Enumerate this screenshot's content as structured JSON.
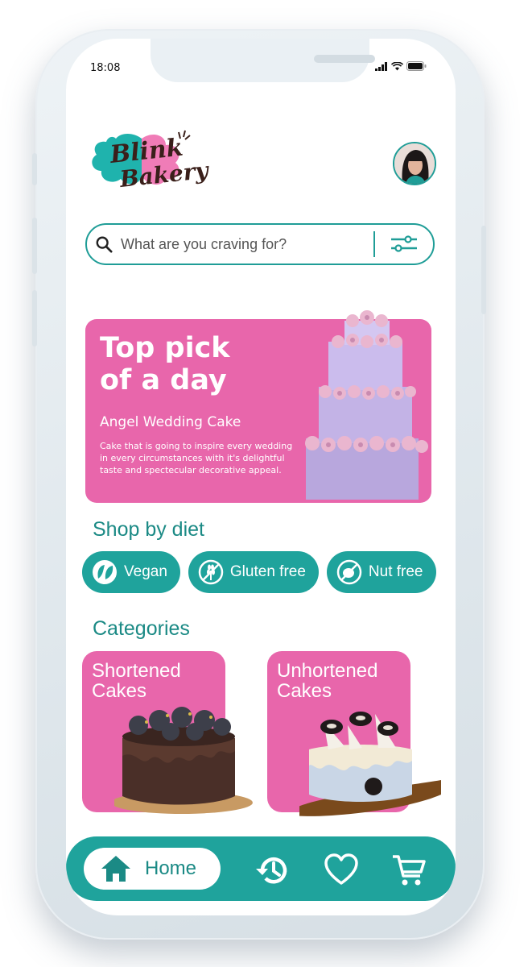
{
  "status_bar": {
    "time": "18:08"
  },
  "brand": {
    "line1": "Blink",
    "line2": "Bakery"
  },
  "search": {
    "placeholder": "What are you craving for?"
  },
  "banner": {
    "title_line1": "Top pick",
    "title_line2": "of a day",
    "product": "Angel Wedding Cake",
    "description": "Cake that is going to inspire every wedding in every circumstances with it's delightful taste and spectecular decorative appeal."
  },
  "diet": {
    "heading": "Shop by diet",
    "items": [
      {
        "label": "Vegan",
        "icon": "leaf-icon"
      },
      {
        "label": "Gluten free",
        "icon": "wheat-icon"
      },
      {
        "label": "Nut free",
        "icon": "nut-icon"
      }
    ]
  },
  "categories": {
    "heading": "Categories",
    "items": [
      {
        "label": "Shortened Cakes"
      },
      {
        "label": "Unhortened Cakes"
      }
    ]
  },
  "nav": {
    "home_label": "Home",
    "icons": [
      "home-icon",
      "history-icon",
      "heart-icon",
      "cart-icon"
    ]
  },
  "colors": {
    "teal": "#1fa39c",
    "pink": "#e866ab"
  }
}
